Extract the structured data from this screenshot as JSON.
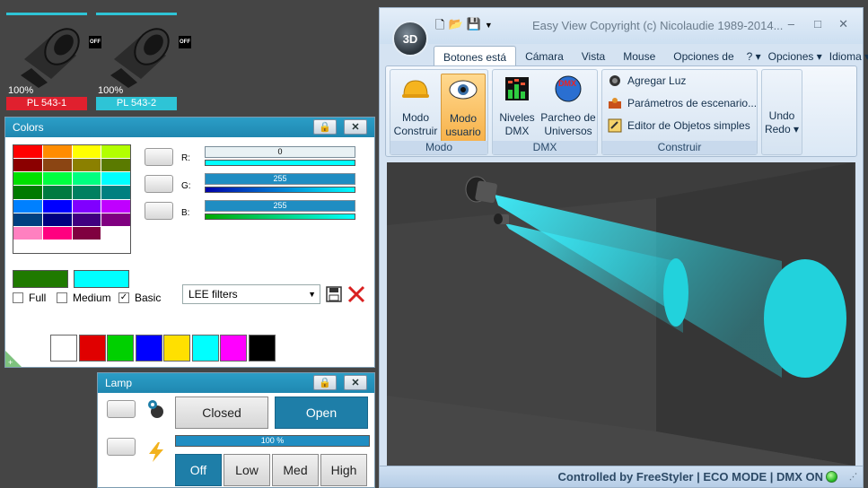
{
  "fixtures": [
    {
      "percent": "100%",
      "name": "PL 543-1",
      "name_bg": "#e0202e",
      "off_label": "OFF"
    },
    {
      "percent": "100%",
      "name": "PL 543-2",
      "name_bg": "#2ec4d6",
      "off_label": "OFF"
    }
  ],
  "colors_panel": {
    "title": "Colors",
    "close": "✕",
    "swatches": [
      "#ff0000",
      "#ff8c00",
      "#ffff00",
      "#b2ff00",
      "#8b0000",
      "#8b4513",
      "#8b8000",
      "#5a7a00",
      "#00e000",
      "#00ff40",
      "#00ff80",
      "#00ffff",
      "#007a00",
      "#007a40",
      "#008060",
      "#008080",
      "#0080ff",
      "#0000ff",
      "#8000ff",
      "#c000ff",
      "#004080",
      "#000080",
      "#400080",
      "#800080",
      "#ff80c0",
      "#ff0080",
      "#800040",
      "#ffffff"
    ],
    "r_label": "R:",
    "g_label": "G:",
    "b_label": "B:",
    "r_value": "0",
    "g_value": "255",
    "b_value": "255",
    "sample_left": "#1f7a00",
    "sample_right": "#00ffff",
    "full_label": "Full",
    "medium_label": "Medium",
    "basic_label": "Basic",
    "basic_checked": "✓",
    "filter_value": "LEE filters",
    "basic_swatches": [
      "#ffffff",
      "#e00000",
      "#00d000",
      "#0000ff",
      "#ffe000",
      "#00ffff",
      "#ff00ff",
      "#000000"
    ]
  },
  "lamp_panel": {
    "title": "Lamp",
    "close": "✕",
    "closed_label": "Closed",
    "open_label": "Open",
    "progress_value": 1.0,
    "progress_text": "100 %",
    "off_label": "Off",
    "low_label": "Low",
    "med_label": "Med",
    "high_label": "High"
  },
  "app": {
    "title": "Easy View   Copyright (c) Nicolaudie 1989-2014...",
    "minimize": "–",
    "maximize": "□",
    "close": "✕",
    "orb_label": "3D",
    "tabs": [
      "Botones está",
      "Cámara",
      "Vista",
      "Mouse",
      "Opciones de",
      "? ▾",
      "Opciones ▾",
      "Idioma ▾"
    ],
    "ribbon": {
      "modo_construir": [
        "Modo",
        "Construir"
      ],
      "modo_usuario": [
        "Modo",
        "usuario"
      ],
      "modo_group": "Modo",
      "niveles": [
        "Niveles",
        "DMX"
      ],
      "parcheo": [
        "Parcheo de",
        "Universos"
      ],
      "dmx_group": "DMX",
      "agregar": "Agregar Luz",
      "parametros": "Parámetros de escenario...",
      "editor": "Editor de Objetos simples",
      "construir_group": "Construir",
      "undo": [
        "Undo",
        "Redo ▾"
      ]
    },
    "status": "Controlled by FreeStyler  |  ECO MODE  |  DMX ON"
  },
  "colors": {
    "accent": "#2b9ec7",
    "cyan": "#2ec4d6",
    "status_led": "#1fb51f"
  }
}
